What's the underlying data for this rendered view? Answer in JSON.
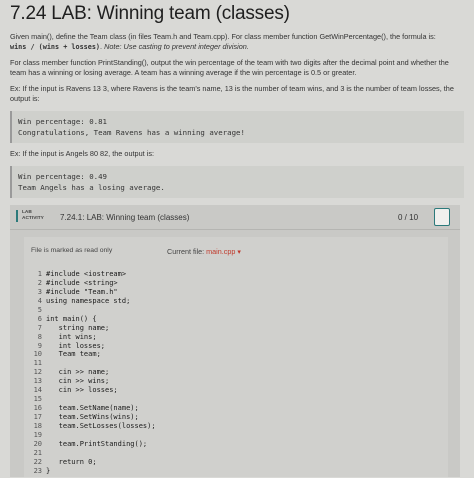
{
  "title": "7.24 LAB: Winning team (classes)",
  "para1": "Given main(), define the Team class (in files Team.h and Team.cpp). For class member function GetWinPercentage(), the formula is:",
  "formula": "wins / (wins + losses)",
  "formula_note": "Note: Use casting to prevent integer division.",
  "para2": "For class member function PrintStanding(), output the win percentage of the team with two digits after the decimal point and whether the team has a winning or losing average. A team has a winning average if the win percentage is 0.5 or greater.",
  "para3": "Ex: If the input is Ravens 13 3, where Ravens is the team's name, 13 is the number of team wins, and 3 is the number of team losses, the output is:",
  "out1": [
    "Win percentage: 0.81",
    "Congratulations, Team Ravens has a winning average!"
  ],
  "para4": "Ex: If the input is Angels 80 82, the output is:",
  "out2": [
    "Win percentage: 0.49",
    "Team Angels has a losing average."
  ],
  "tag": "447382.3130836.qx3zqy7",
  "lab": {
    "badge_line1": "LAB",
    "badge_line2": "ACTIVITY",
    "title": "7.24.1: LAB: Winning team (classes)",
    "score": "0 / 10"
  },
  "editor": {
    "readonly": "File is marked as read only",
    "current_label": "Current file:",
    "current_file": "main.cpp",
    "lines": [
      "#include <iostream>",
      "#include <string>",
      "#include \"Team.h\"",
      "using namespace std;",
      "",
      "int main() {",
      "   string name;",
      "   int wins;",
      "   int losses;",
      "   Team team;",
      "",
      "   cin >> name;",
      "   cin >> wins;",
      "   cin >> losses;",
      "",
      "   team.SetName(name);",
      "   team.SetWins(wins);",
      "   team.SetLosses(losses);",
      "",
      "   team.PrintStanding();",
      "",
      "   return 0;",
      "}"
    ]
  }
}
